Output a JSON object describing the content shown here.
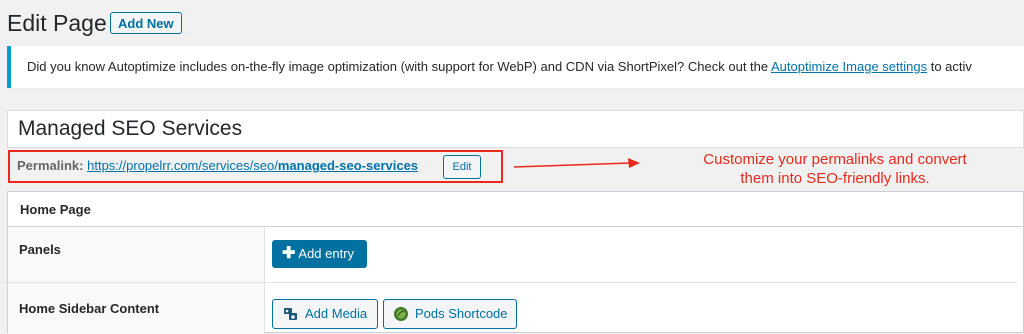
{
  "header": {
    "title": "Edit Page",
    "add_new_label": "Add New"
  },
  "notice": {
    "text_before": "Did you know Autoptimize includes on-the-fly image optimization (with support for WebP) and CDN via ShortPixel? Check out the ",
    "link_text": "Autoptimize Image settings",
    "text_after": " to activ"
  },
  "post": {
    "title": "Managed SEO Services"
  },
  "permalink": {
    "label": "Permalink:",
    "base_url": "https://propelrr.com/services/seo/",
    "slug": "managed-seo-services",
    "edit_label": "Edit"
  },
  "annotation": {
    "line1": "Customize your permalinks and convert",
    "line2": "them into SEO-friendly links."
  },
  "metabox": {
    "title": "Home Page",
    "fields": [
      {
        "label": "Panels",
        "button_label": "Add entry"
      },
      {
        "label": "Home Sidebar Content",
        "media_label": "Add Media",
        "shortcode_label": "Pods Shortcode"
      }
    ]
  },
  "colors": {
    "accent": "#0071a1",
    "annotation_red": "#e8291c",
    "notice_border": "#00a0d2"
  },
  "icons": {
    "add_entry": "plus-icon",
    "add_media": "media-icon",
    "pods": "pods-icon",
    "arrow": "arrow-right-icon"
  }
}
